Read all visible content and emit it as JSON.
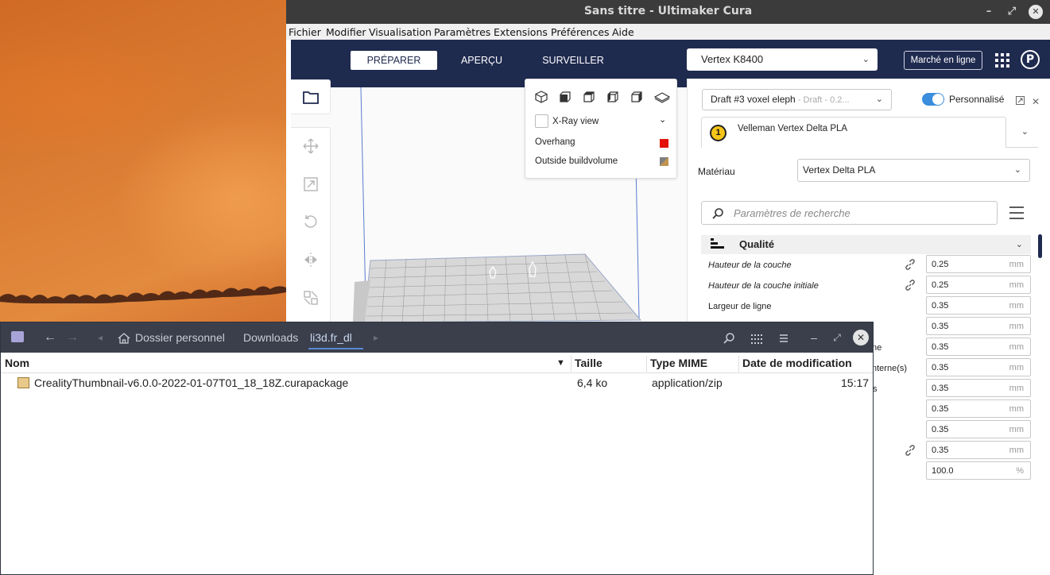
{
  "cura": {
    "window_title": "Sans titre - Ultimaker Cura",
    "menu": [
      "Fichier",
      "Modifier",
      "Visualisation",
      "Paramètres",
      "Extensions",
      "Préférences",
      "Aide"
    ],
    "menu_mnemonic": [
      "F",
      "M",
      "V",
      "P",
      "E",
      "P",
      "A"
    ],
    "stages": [
      "PRÉPARER",
      "APERÇU",
      "SURVEILLER"
    ],
    "active_stage": "PRÉPARER",
    "printer": "Vertex K8400",
    "marketplace_label": "Marché en ligne",
    "profile_initial": "P",
    "view_panel": {
      "xray_label": "X-Ray view",
      "overhang_label": "Overhang",
      "overhang_color": "#e3120b",
      "outside_label": "Outside buildvolume"
    },
    "settings": {
      "profile_name": "Draft #3 voxel eleph",
      "profile_sub": " - Draft - 0.2...",
      "custom_label": "Personnalisé",
      "extruder_number": "1",
      "extruder_name": "Velleman Vertex Delta PLA",
      "material_label": "Matériau",
      "material_value": "Vertex Delta PLA",
      "search_placeholder": "Paramètres de recherche",
      "section_title": "Qualité",
      "rows": [
        {
          "label": "Hauteur de la couche",
          "italic": true,
          "linked": true,
          "value": "0.25",
          "unit": "mm"
        },
        {
          "label": "Hauteur de la couche initiale",
          "italic": true,
          "linked": true,
          "value": "0.25",
          "unit": "mm"
        },
        {
          "label": "Largeur de ligne",
          "italic": false,
          "linked": false,
          "value": "0.35",
          "unit": "mm"
        },
        {
          "label": "",
          "italic": false,
          "linked": false,
          "value": "0.35",
          "unit": "mm"
        },
        {
          "label": "ne",
          "italic": false,
          "linked": false,
          "value": "0.35",
          "unit": "mm"
        },
        {
          "label": "nterne(s)",
          "italic": false,
          "linked": false,
          "value": "0.35",
          "unit": "mm"
        },
        {
          "label": "s",
          "italic": false,
          "linked": false,
          "value": "0.35",
          "unit": "mm"
        },
        {
          "label": "",
          "italic": false,
          "linked": false,
          "value": "0.35",
          "unit": "mm"
        },
        {
          "label": "",
          "italic": false,
          "linked": false,
          "value": "0.35",
          "unit": "mm"
        },
        {
          "label": "",
          "italic": false,
          "linked": true,
          "value": "0.35",
          "unit": "mm"
        },
        {
          "label": "",
          "italic": false,
          "linked": false,
          "value": "100.0",
          "unit": "%"
        }
      ]
    }
  },
  "file_manager": {
    "breadcrumb": [
      "Dossier personnel",
      "Downloads",
      "li3d.fr_dl"
    ],
    "columns": [
      "Nom",
      "Taille",
      "Type MIME",
      "Date de modification"
    ],
    "files": [
      {
        "name": "CrealityThumbnail-v6.0.0-2022-01-07T01_18_18Z.curapackage",
        "size": "6,4 ko",
        "mime": "application/zip",
        "date": "15:17"
      }
    ]
  }
}
